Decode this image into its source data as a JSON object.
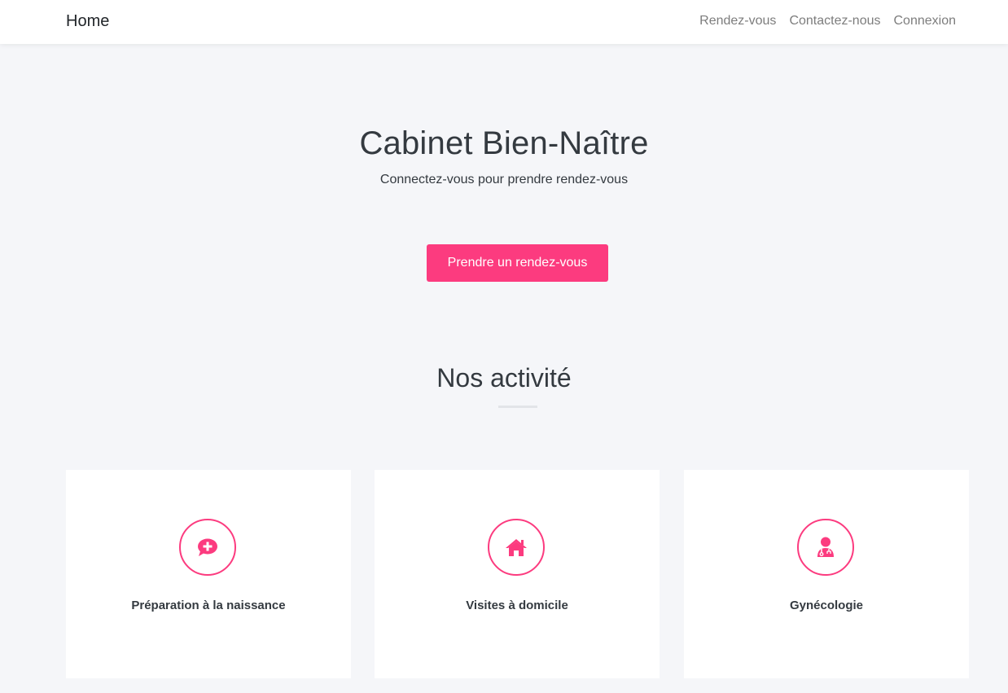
{
  "navbar": {
    "brand": "Home",
    "links": [
      "Rendez-vous",
      "Contactez-nous",
      "Connexion"
    ]
  },
  "hero": {
    "title": "Cabinet Bien-Naître",
    "subtitle": "Connectez-vous pour prendre rendez-vous",
    "cta_label": "Prendre un rendez-vous"
  },
  "activities": {
    "title": "Nos activité",
    "items": [
      {
        "label": "Préparation à la naissance",
        "icon": "comment-medical-icon"
      },
      {
        "label": "Visites à domicile",
        "icon": "home-icon"
      },
      {
        "label": "Gynécologie",
        "icon": "user-doctor-icon"
      }
    ]
  },
  "colors": {
    "accent": "#fc3b7f",
    "background": "#f5f6f9",
    "card": "#ffffff",
    "text": "#343a40",
    "nav_link": "#7d7d7d"
  }
}
